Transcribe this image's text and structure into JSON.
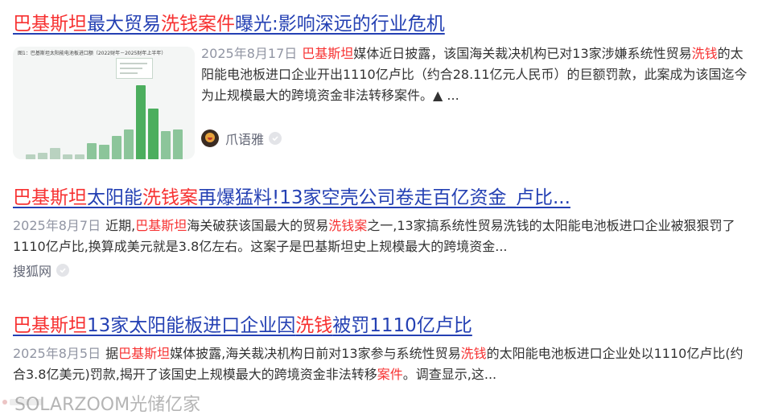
{
  "results": [
    {
      "title_parts": [
        {
          "text": "巴基斯坦",
          "hl": true
        },
        {
          "text": "最大贸易",
          "hl": false
        },
        {
          "text": "洗钱案件",
          "hl": true
        },
        {
          "text": "曝光:影响深远的行业危机",
          "hl": false
        }
      ],
      "date": "2025年8月17日",
      "abstract_parts": [
        {
          "text": "巴基斯坦",
          "hl": true
        },
        {
          "text": "媒体近日披露，该国海关裁决机构已对13家涉嫌系统性贸易",
          "hl": false
        },
        {
          "text": "洗钱",
          "hl": true
        },
        {
          "text": "的太阳能电池板进口企业开出1110亿卢比（约合28.11亿元人民币）的巨额罚款，此案成为该国迄今为止规模最大的跨境资金非法转移案件。▲ ...",
          "hl": false
        }
      ],
      "source": "爪语雅",
      "thumbnail": {
        "caption": "图1：巴基斯坦太阳能电池板进口额（2022财年－2025财年上半年）",
        "bars": [
          {
            "value": 0.3,
            "color": "#b9d2c0"
          },
          {
            "value": 0.4,
            "color": "#b9d2c0"
          },
          {
            "value": 0.7,
            "color": "#b9d2c0"
          },
          {
            "value": 0.3,
            "color": "#b9d2c0"
          },
          {
            "value": 0.3,
            "color": "#b9d2c0"
          },
          {
            "value": 1.0,
            "color": "#8cc59a"
          },
          {
            "value": 0.9,
            "color": "#8cc59a"
          },
          {
            "value": 1.4,
            "color": "#8cc59a"
          },
          {
            "value": 1.8,
            "color": "#8cc59a"
          },
          {
            "value": 4.5,
            "color": "#4cae5e"
          },
          {
            "value": 3.1,
            "color": "#4cae5e"
          },
          {
            "value": 1.7,
            "color": "#8cc59a"
          },
          {
            "value": 1.8,
            "color": "#8cc59a"
          }
        ],
        "max_value": 5
      }
    },
    {
      "title_parts": [
        {
          "text": "巴基斯坦",
          "hl": true
        },
        {
          "text": "太阳能",
          "hl": false
        },
        {
          "text": "洗钱案",
          "hl": true
        },
        {
          "text": "再爆猛料!13家空壳公司卷走百亿资金_卢比...",
          "hl": false
        }
      ],
      "date": "2025年8月7日",
      "abstract_parts": [
        {
          "text": "近期,",
          "hl": false
        },
        {
          "text": "巴基斯坦",
          "hl": true
        },
        {
          "text": "海关破获该国最大的贸易",
          "hl": false
        },
        {
          "text": "洗钱案",
          "hl": true
        },
        {
          "text": "之一,13家搞系统性贸易洗钱的太阳能电池板进口企业被狠狠罚了1110亿卢比,换算成美元就是3.8亿左右。这案子是巴基斯坦史上规模最大的跨境资金...",
          "hl": false
        }
      ],
      "source": "搜狐网"
    },
    {
      "title_parts": [
        {
          "text": "巴基斯坦",
          "hl": true
        },
        {
          "text": "13家太阳能板进口企业因",
          "hl": false
        },
        {
          "text": "洗钱",
          "hl": true
        },
        {
          "text": "被罚1110亿卢比",
          "hl": false
        }
      ],
      "date": "2025年8月5日",
      "abstract_parts": [
        {
          "text": "据",
          "hl": false
        },
        {
          "text": "巴基斯坦",
          "hl": true
        },
        {
          "text": "媒体披露,海关裁决机构日前对13家参与系统性贸易",
          "hl": false
        },
        {
          "text": "洗钱",
          "hl": true
        },
        {
          "text": "的太阳能电池板进口企业处以1110亿卢比(约合3.8亿美元)罚款,揭开了该国史上规模最大的跨境资金非法转移",
          "hl": false
        },
        {
          "text": "案件",
          "hl": true
        },
        {
          "text": "。调查显示,这...",
          "hl": false
        }
      ],
      "source": ""
    }
  ],
  "watermark": "SOLARZOOM光储亿家",
  "colors": {
    "link": "#2440b3",
    "highlight": "#f73131",
    "date": "#9195a3",
    "source": "#626675"
  },
  "icons": {
    "verified": "check-circle-icon",
    "avatar": "source-avatar"
  }
}
